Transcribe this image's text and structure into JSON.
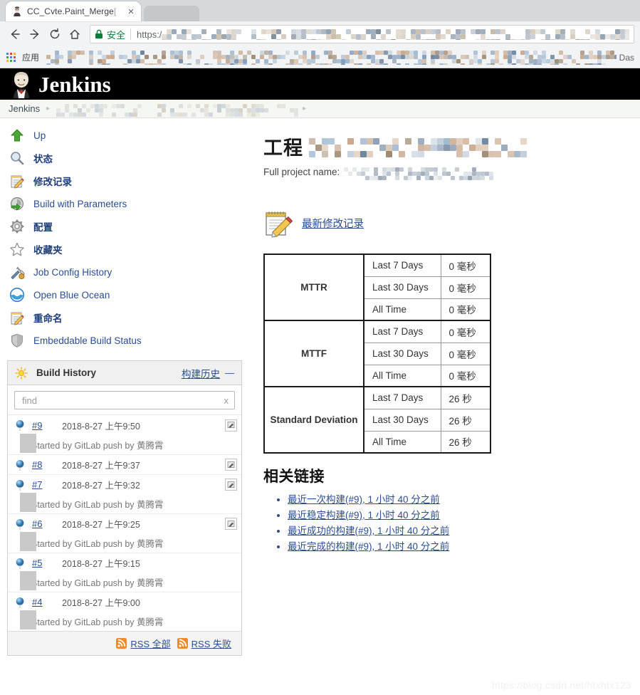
{
  "browser": {
    "tab": {
      "title": "CC_Cvte.Paint_Merge",
      "title_suffix": "[",
      "favicon_name": "jenkins-favicon",
      "close_label": "×"
    },
    "nav": {
      "back_label": "←",
      "forward_label": "→",
      "reload_label": "↻",
      "home_label": "⌂"
    },
    "omnibox": {
      "secure_label": "安全",
      "url_prefix": "https:/",
      "url_redacted": true
    },
    "bookmarks": {
      "apps_label": "应用",
      "tail_label": "Das",
      "redacted": true
    }
  },
  "jenkins": {
    "logo_text": "Jenkins",
    "breadcrumb": {
      "root": "Jenkins",
      "separator": "›",
      "redacted_items": 3
    },
    "sidebar": {
      "items": [
        {
          "label": "Up",
          "icon": "up-arrow-icon",
          "bold": false
        },
        {
          "label": "状态",
          "icon": "magnifier-icon",
          "bold": true
        },
        {
          "label": "修改记录",
          "icon": "notepad-pencil-icon",
          "bold": true
        },
        {
          "label": "Build with Parameters",
          "icon": "clock-play-icon",
          "bold": false
        },
        {
          "label": "配置",
          "icon": "gear-icon",
          "bold": true
        },
        {
          "label": "收藏夹",
          "icon": "star-icon",
          "bold": true
        },
        {
          "label": "Job Config History",
          "icon": "tools-icon",
          "bold": false
        },
        {
          "label": "Open Blue Ocean",
          "icon": "blue-ocean-icon",
          "bold": false
        },
        {
          "label": "重命名",
          "icon": "notepad-pencil-icon",
          "bold": true
        },
        {
          "label": "Embeddable Build Status",
          "icon": "shield-icon",
          "bold": false
        }
      ]
    },
    "build_history": {
      "title": "Build History",
      "cn_link": "构建历史",
      "collapse_label": "—",
      "find_placeholder": "find",
      "find_value": "",
      "find_clear": "x",
      "builds": [
        {
          "number": "#9",
          "time": "2018-8-27 上午9:50",
          "status": "blue",
          "has_console": true,
          "description": "Started by GitLab push by 黄腾霄"
        },
        {
          "number": "#8",
          "time": "2018-8-27 上午9:37",
          "status": "blue",
          "has_console": true,
          "description": ""
        },
        {
          "number": "#7",
          "time": "2018-8-27 上午9:32",
          "status": "blue",
          "has_console": true,
          "description": "Started by GitLab push by 黄腾霄"
        },
        {
          "number": "#6",
          "time": "2018-8-27 上午9:25",
          "status": "blue",
          "has_console": true,
          "description": "Started by GitLab push by 黄腾霄"
        },
        {
          "number": "#5",
          "time": "2018-8-27 上午9:15",
          "status": "blue",
          "has_console": false,
          "description": "Started by GitLab push by 黄腾霄"
        },
        {
          "number": "#4",
          "time": "2018-8-27 上午9:00",
          "status": "blue",
          "has_console": false,
          "description": "Started by GitLab push by 黄腾霄"
        }
      ],
      "rss_all": "RSS 全部",
      "rss_failed": "RSS 失败"
    },
    "main": {
      "title_prefix": "工程",
      "title_redacted": true,
      "full_project_label": "Full project name:",
      "full_project_redacted": true,
      "changes_link": "最新修改记录",
      "stats": {
        "groups": [
          {
            "name": "MTTR",
            "rows": [
              {
                "period": "Last 7 Days",
                "value": "0 毫秒"
              },
              {
                "period": "Last 30 Days",
                "value": "0 毫秒"
              },
              {
                "period": "All Time",
                "value": "0 毫秒"
              }
            ]
          },
          {
            "name": "MTTF",
            "rows": [
              {
                "period": "Last 7 Days",
                "value": "0 毫秒"
              },
              {
                "period": "Last 30 Days",
                "value": "0 毫秒"
              },
              {
                "period": "All Time",
                "value": "0 毫秒"
              }
            ]
          },
          {
            "name": "Standard Deviation",
            "rows": [
              {
                "period": "Last 7 Days",
                "value": "26 秒"
              },
              {
                "period": "Last 30 Days",
                "value": "26 秒"
              },
              {
                "period": "All Time",
                "value": "26 秒"
              }
            ]
          }
        ]
      },
      "related_title": "相关链接",
      "related_links": [
        "最近一次构建(#9), 1 小时 40 分之前",
        "最近稳定构建(#9), 1 小时 40 分之前",
        "最近成功的构建(#9), 1 小时 40 分之前",
        "最近完成的构建(#9), 1 小时 40 分之前"
      ]
    }
  },
  "watermark": "https://blog.csdn.net/htxhtx123",
  "colors": {
    "link": "#2a4d8f",
    "header_bg": "#000000",
    "breadcrumb_bg": "#f5f7f2",
    "secure_green": "#0b7c39",
    "rss_orange": "#f08a24",
    "status_ball": "#4a90d9"
  }
}
